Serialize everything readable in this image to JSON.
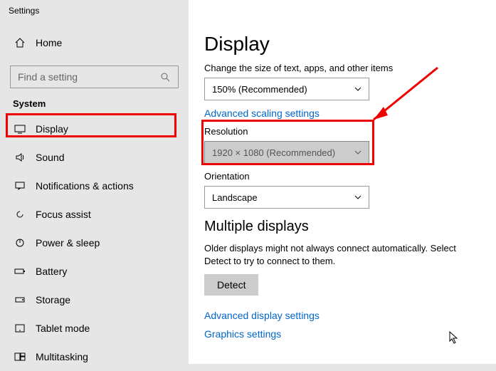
{
  "window": {
    "title": "Settings"
  },
  "sidebar": {
    "home": "Home",
    "search_placeholder": "Find a setting",
    "category": "System",
    "items": [
      "Display",
      "Sound",
      "Notifications & actions",
      "Focus assist",
      "Power & sleep",
      "Battery",
      "Storage",
      "Tablet mode",
      "Multitasking"
    ]
  },
  "main": {
    "heading": "Display",
    "scale_label": "Change the size of text, apps, and other items",
    "scale_value": "150% (Recommended)",
    "adv_scaling": "Advanced scaling settings",
    "res_label": "Resolution",
    "res_value": "1920 × 1080 (Recommended)",
    "orient_label": "Orientation",
    "orient_value": "Landscape",
    "multi_heading": "Multiple displays",
    "multi_desc": "Older displays might not always connect automatically. Select Detect to try to connect to them.",
    "detect": "Detect",
    "adv_display": "Advanced display settings",
    "graphics": "Graphics settings"
  }
}
